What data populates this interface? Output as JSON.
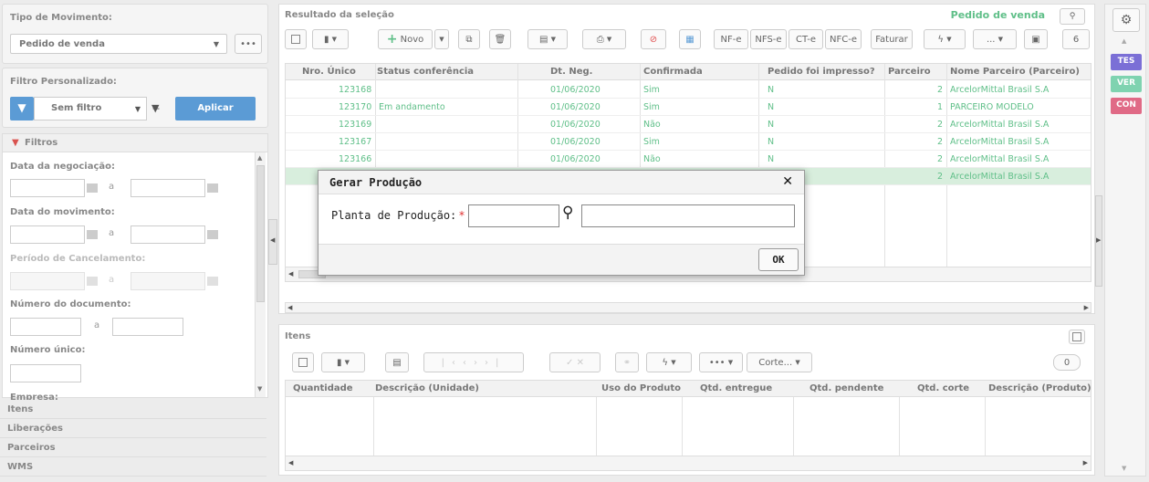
{
  "left": {
    "tipo_label": "Tipo de Movimento:",
    "tipo_value": "Pedido de venda",
    "tipo_more": "•••",
    "filtro_label": "Filtro Personalizado:",
    "filtro_value": "Sem filtro",
    "aplicar": "Aplicar",
    "filtros_header": "Filtros",
    "f1": "Data da negociação:",
    "f2": "Data do movimento:",
    "f3": "Período de Cancelamento:",
    "f4": "Número do documento:",
    "f5": "Número único:",
    "f6": "Empresa:",
    "a": "a",
    "sections": [
      "Itens",
      "Liberações",
      "Parceiros",
      "WMS"
    ]
  },
  "main": {
    "title": "Resultado da seleção",
    "context_title": "Pedido de venda",
    "toolbar": {
      "novo": "Novo",
      "nfe": "NF-e",
      "nfse": "NFS-e",
      "cte": "CT-e",
      "nfce": "NFC-e",
      "faturar": "Faturar",
      "more": "...",
      "count": "6"
    },
    "columns": [
      "Nro. Único",
      "Status conferência",
      "Dt. Neg.",
      "Confirmada",
      "Pedido foi impresso?",
      "Parceiro",
      "Nome Parceiro (Parceiro)"
    ],
    "rows": [
      {
        "nro": "123168",
        "status": "",
        "dt": "01/06/2020",
        "conf": "Sim",
        "imp": "N",
        "parc": "2",
        "nome": "ArcelorMittal Brasil S.A"
      },
      {
        "nro": "123170",
        "status": "Em andamento",
        "dt": "01/06/2020",
        "conf": "Sim",
        "imp": "N",
        "parc": "1",
        "nome": "PARCEIRO MODELO"
      },
      {
        "nro": "123169",
        "status": "",
        "dt": "01/06/2020",
        "conf": "Não",
        "imp": "N",
        "parc": "2",
        "nome": "ArcelorMittal Brasil S.A"
      },
      {
        "nro": "123167",
        "status": "",
        "dt": "01/06/2020",
        "conf": "Sim",
        "imp": "N",
        "parc": "2",
        "nome": "ArcelorMittal Brasil S.A"
      },
      {
        "nro": "123166",
        "status": "",
        "dt": "01/06/2020",
        "conf": "Não",
        "imp": "N",
        "parc": "2",
        "nome": "ArcelorMittal Brasil S.A"
      },
      {
        "nro": "",
        "status": "",
        "dt": "",
        "conf": "",
        "imp": "",
        "parc": "2",
        "nome": "ArcelorMittal Brasil S.A"
      }
    ]
  },
  "itens": {
    "title": "Itens",
    "corte": "Corte...",
    "more": "•••",
    "count": "0",
    "columns": [
      "Quantidade",
      "Descrição (Unidade)",
      "Uso do Produto",
      "Qtd. entregue",
      "Qtd. pendente",
      "Qtd. corte",
      "Descrição (Produto)"
    ]
  },
  "dialog": {
    "title": "Gerar Produção",
    "close": "✕",
    "label": "Planta de Produção:",
    "required": "*",
    "ok": "OK"
  },
  "right": {
    "badges": [
      "TES",
      "VER",
      "CON"
    ]
  },
  "colors": {
    "accent_green": "#5fbf88",
    "blue": "#5b9bd5",
    "badge_tes": "#7b6fd6",
    "badge_ver": "#7fd3b0",
    "badge_con": "#e06a86"
  }
}
